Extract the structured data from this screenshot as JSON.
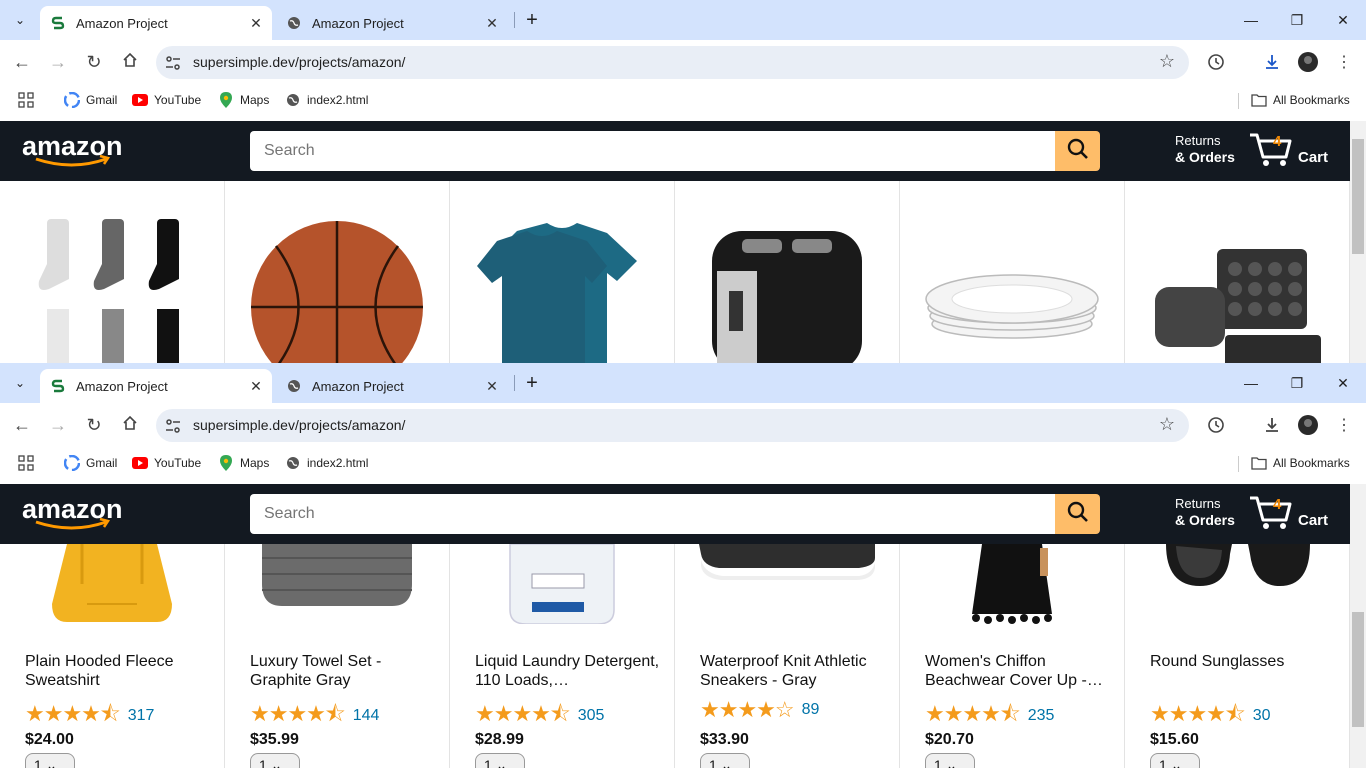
{
  "browser": {
    "tabs": [
      {
        "label": "Amazon Project",
        "active": true
      },
      {
        "label": "Amazon Project",
        "active": false
      }
    ],
    "url": "supersimple.dev/projects/amazon/",
    "bookmarks": [
      {
        "label": "Gmail",
        "icon": "gmail-icon"
      },
      {
        "label": "YouTube",
        "icon": "youtube-icon"
      },
      {
        "label": "Maps",
        "icon": "maps-icon"
      },
      {
        "label": "index2.html",
        "icon": "globe-icon"
      }
    ],
    "all_bookmarks": "All Bookmarks"
  },
  "amazon": {
    "search_placeholder": "Search",
    "returns_line1": "Returns",
    "returns_line2": "& Orders",
    "cart_count": "4",
    "cart_label": "Cart"
  },
  "top_products": [
    {
      "image": "socks-image"
    },
    {
      "image": "basketball-image"
    },
    {
      "image": "tshirts-image"
    },
    {
      "image": "toaster-image"
    },
    {
      "image": "plates-image"
    },
    {
      "image": "bakeware-image"
    }
  ],
  "products": [
    {
      "name": "Plain Hooded Fleece Sweatshirt",
      "rating": 4.5,
      "count": "317",
      "price": "$24.00",
      "qty": "1",
      "image": "hoodie-image"
    },
    {
      "name": "Luxury Towel Set - Graphite Gray",
      "rating": 4.5,
      "count": "144",
      "price": "$35.99",
      "qty": "1",
      "image": "towel-image"
    },
    {
      "name": "Liquid Laundry Detergent, 110 Loads,…",
      "rating": 4.5,
      "count": "305",
      "price": "$28.99",
      "qty": "1",
      "image": "detergent-image"
    },
    {
      "name": "Waterproof Knit Athletic Sneakers - Gray",
      "rating": 4.0,
      "count": "89",
      "price": "$33.90",
      "qty": "1",
      "image": "sneaker-image"
    },
    {
      "name": "Women's Chiffon Beachwear Cover Up -…",
      "rating": 4.5,
      "count": "235",
      "price": "$20.70",
      "qty": "1",
      "image": "coverup-image"
    },
    {
      "name": "Round Sunglasses",
      "rating": 4.5,
      "count": "30",
      "price": "$15.60",
      "qty": "1",
      "image": "sunglasses-image"
    }
  ]
}
